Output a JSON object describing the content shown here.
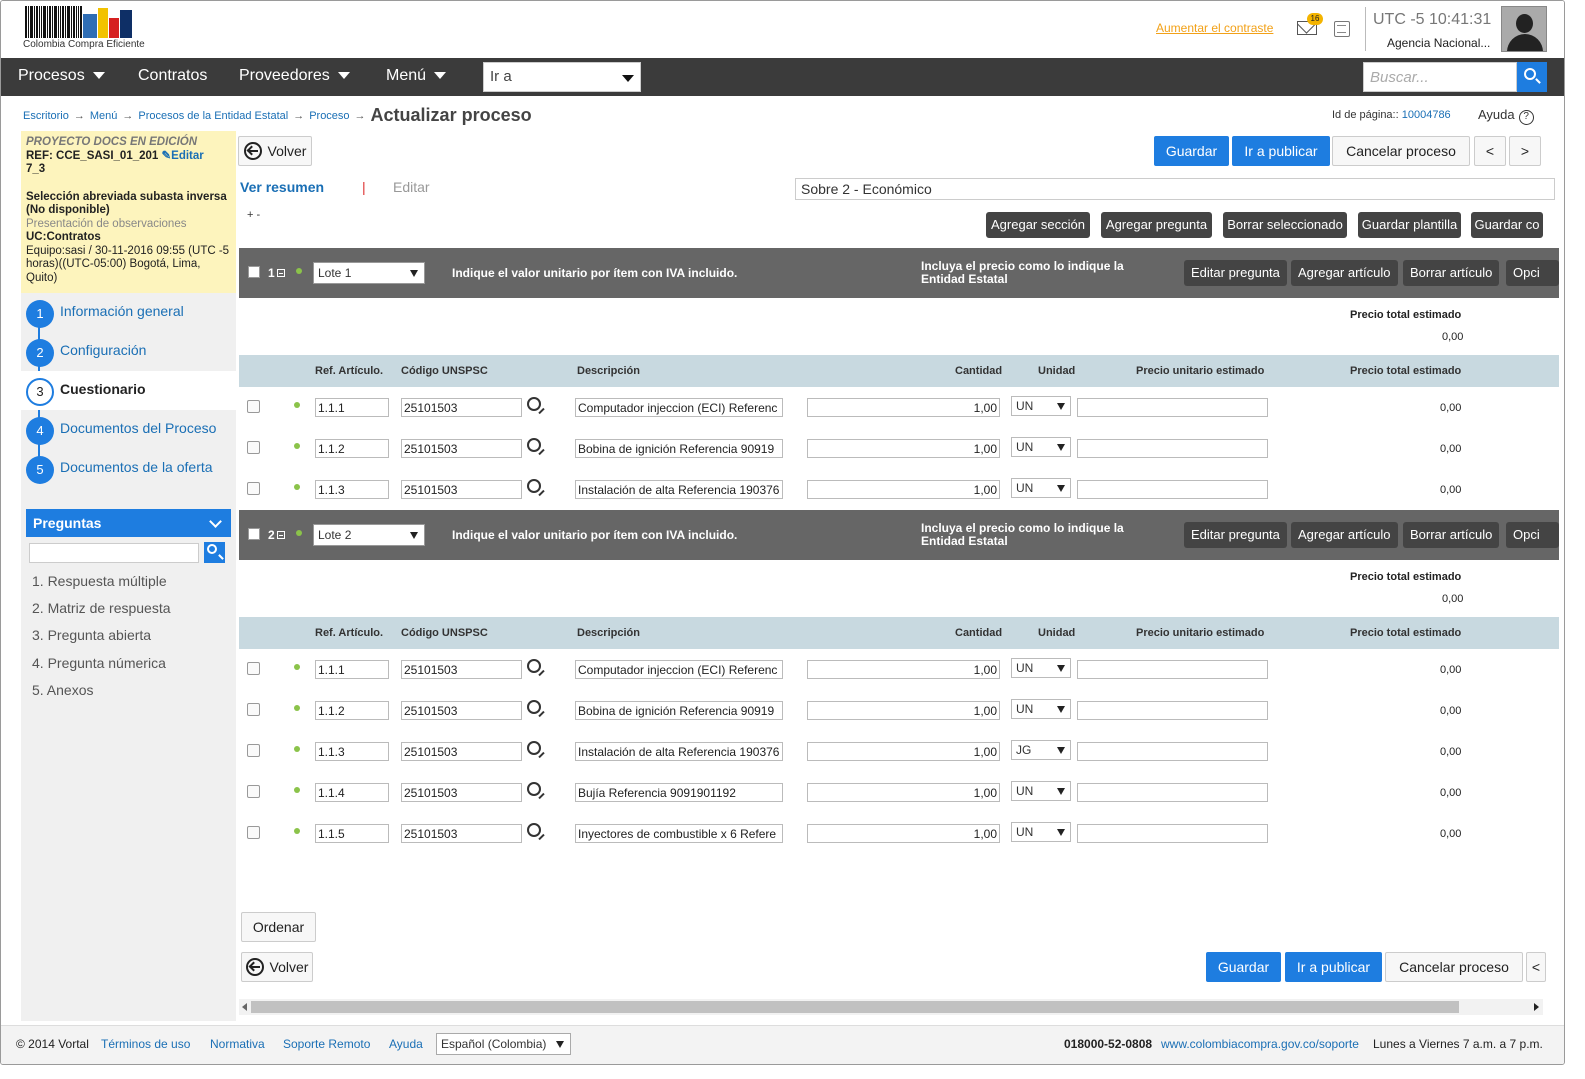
{
  "header": {
    "logo_text": "Colombia Compra Eficiente",
    "contrast_link": "Aumentar el contraste",
    "mail_badge": "16",
    "clock": "UTC -5 10:41:31",
    "agency": "Agencia Nacional..."
  },
  "nav": {
    "items": [
      "Procesos",
      "Contratos",
      "Proveedores",
      "Menú"
    ],
    "goto_value": "Ir a",
    "search_placeholder": "Buscar..."
  },
  "breadcrumb": {
    "items": [
      "Escritorio",
      "Menú",
      "Procesos de la Entidad Estatal",
      "Proceso"
    ],
    "current": "Actualizar proceso"
  },
  "page_id": {
    "label": "Id de página::",
    "value": "10004786"
  },
  "help": "Ayuda",
  "info": {
    "status": "PROYECTO DOCS EN EDICIÓN",
    "ref_line1": "REF: CCE_SASI_01_201",
    "ref_line2": "7_3",
    "edit": "Editar",
    "modality": "Selección abreviada subasta inversa (No disponible)",
    "phase": "Presentación de observaciones",
    "uc": "UC:Contratos",
    "team": "Equipo:sasi / 30-11-2016 09:55 (UTC -5 horas)((UTC-05:00) Bogotá, Lima, Quito)"
  },
  "steps": [
    {
      "n": "1",
      "label": "Información general"
    },
    {
      "n": "2",
      "label": "Configuración"
    },
    {
      "n": "3",
      "label": "Cuestionario"
    },
    {
      "n": "4",
      "label": "Documentos del Proceso"
    },
    {
      "n": "5",
      "label": "Documentos de la oferta"
    }
  ],
  "questions": {
    "title": "Preguntas",
    "items": [
      "1.  Respuesta múltiple",
      "2.  Matriz de respuesta",
      "3.  Pregunta abierta",
      "4.  Pregunta númerica",
      "5.  Anexos"
    ]
  },
  "toolbar": {
    "back": "Volver",
    "save": "Guardar",
    "publish": "Ir a publicar",
    "cancel": "Cancelar proceso",
    "prev": "<",
    "next": ">"
  },
  "tabs": {
    "summary": "Ver resumen",
    "sep": "|",
    "edit": "Editar"
  },
  "envelope": "Sobre 2 - Económico",
  "expand_collapse": "+  -",
  "section_buttons": [
    "Agregar sección",
    "Agregar pregunta",
    "Borrar seleccionado",
    "Guardar plantilla",
    "Guardar co"
  ],
  "columns": {
    "ref": "Ref. Artículo.",
    "code": "Código UNSPSC",
    "desc": "Descripción",
    "qty": "Cantidad",
    "unit": "Unidad",
    "unit_price": "Precio unitario estimado",
    "total": "Precio total estimado"
  },
  "lots": [
    {
      "num": "1",
      "select": "Lote 1",
      "instruction": "Indique el valor unitario por ítem con IVA incluido.",
      "instruction2": "Incluya el precio como lo indique la Entidad Estatal",
      "buttons": [
        "Editar pregunta",
        "Agregar artículo",
        "Borrar artículo",
        "Opci"
      ],
      "total_label": "Precio total estimado",
      "total_value": "0,00",
      "rows": [
        {
          "ref": "1.1.1",
          "code": "25101503",
          "desc": "Computador injeccion (ECI) Referenc",
          "qty": "1,00",
          "unit": "UN",
          "total": "0,00"
        },
        {
          "ref": "1.1.2",
          "code": "25101503",
          "desc": "Bobina de ignición  Referencia 90919",
          "qty": "1,00",
          "unit": "UN",
          "total": "0,00"
        },
        {
          "ref": "1.1.3",
          "code": "25101503",
          "desc": "Instalación de alta Referencia 190376",
          "qty": "1,00",
          "unit": "UN",
          "total": "0,00"
        }
      ]
    },
    {
      "num": "2",
      "select": "Lote 2",
      "instruction": "Indique el valor unitario por ítem con IVA incluido.",
      "instruction2": "Incluya el precio como lo indique la Entidad Estatal",
      "buttons": [
        "Editar pregunta",
        "Agregar artículo",
        "Borrar artículo",
        "Opci"
      ],
      "total_label": "Precio total estimado",
      "total_value": "0,00",
      "rows": [
        {
          "ref": "1.1.1",
          "code": "25101503",
          "desc": "Computador injeccion (ECI) Referenc",
          "qty": "1,00",
          "unit": "UN",
          "total": "0,00"
        },
        {
          "ref": "1.1.2",
          "code": "25101503",
          "desc": "Bobina de ignición  Referencia 90919",
          "qty": "1,00",
          "unit": "UN",
          "total": "0,00"
        },
        {
          "ref": "1.1.3",
          "code": "25101503",
          "desc": "Instalación de alta Referencia 190376",
          "qty": "1,00",
          "unit": "JG",
          "total": "0,00"
        },
        {
          "ref": "1.1.4",
          "code": "25101503",
          "desc": "Bujía Referencia 9091901192",
          "qty": "1,00",
          "unit": "UN",
          "total": "0,00"
        },
        {
          "ref": "1.1.5",
          "code": "25101503",
          "desc": "Inyectores de combustible x 6 Refere",
          "qty": "1,00",
          "unit": "UN",
          "total": "0,00"
        }
      ]
    }
  ],
  "bottom": {
    "order": "Ordenar",
    "back": "Volver",
    "save": "Guardar",
    "publish": "Ir a publicar",
    "cancel": "Cancelar proceso",
    "more": "<"
  },
  "footer": {
    "copyright": "© 2014 Vortal",
    "links": [
      "Términos de uso",
      "Normativa",
      "Soporte Remoto",
      "Ayuda"
    ],
    "language": "Español (Colombia)",
    "phone": "018000-52-0808",
    "support_url": "www.colombiacompra.gov.co/soporte",
    "hours": "Lunes a Viernes 7 a.m. a 7 p.m."
  },
  "colors": {
    "accent": "#1e7de0",
    "nav_bg": "#3b3b3b",
    "lot_bar": "#666666",
    "table_header": "#c8d9e0",
    "info_bg": "#fdf4bd"
  }
}
